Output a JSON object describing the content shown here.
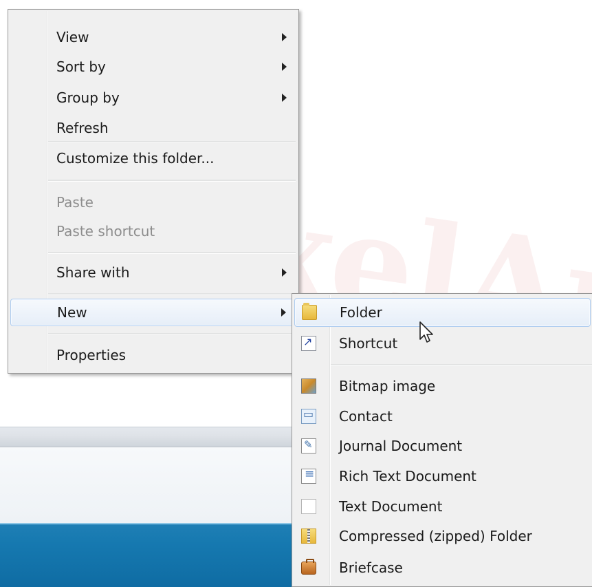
{
  "context_menu": {
    "items": [
      {
        "label": "View"
      },
      {
        "label": "Sort by"
      },
      {
        "label": "Group by"
      },
      {
        "label": "Refresh"
      },
      {
        "label": "Customize this folder..."
      },
      {
        "label": "Paste"
      },
      {
        "label": "Paste shortcut"
      },
      {
        "label": "Share with"
      },
      {
        "label": "New"
      },
      {
        "label": "Properties"
      }
    ]
  },
  "new_submenu": {
    "items": [
      {
        "label": "Folder",
        "icon": "folder-icon"
      },
      {
        "label": "Shortcut",
        "icon": "shortcut-icon"
      },
      {
        "label": "Bitmap image",
        "icon": "bitmap-image-icon"
      },
      {
        "label": "Contact",
        "icon": "contact-icon"
      },
      {
        "label": "Journal Document",
        "icon": "journal-document-icon"
      },
      {
        "label": "Rich Text Document",
        "icon": "rich-text-document-icon"
      },
      {
        "label": "Text Document",
        "icon": "text-document-icon"
      },
      {
        "label": "Compressed (zipped) Folder",
        "icon": "compressed-folder-icon"
      },
      {
        "label": "Briefcase",
        "icon": "briefcase-icon"
      }
    ]
  },
  "watermark": {
    "text": "PixelAmooz.ir"
  }
}
